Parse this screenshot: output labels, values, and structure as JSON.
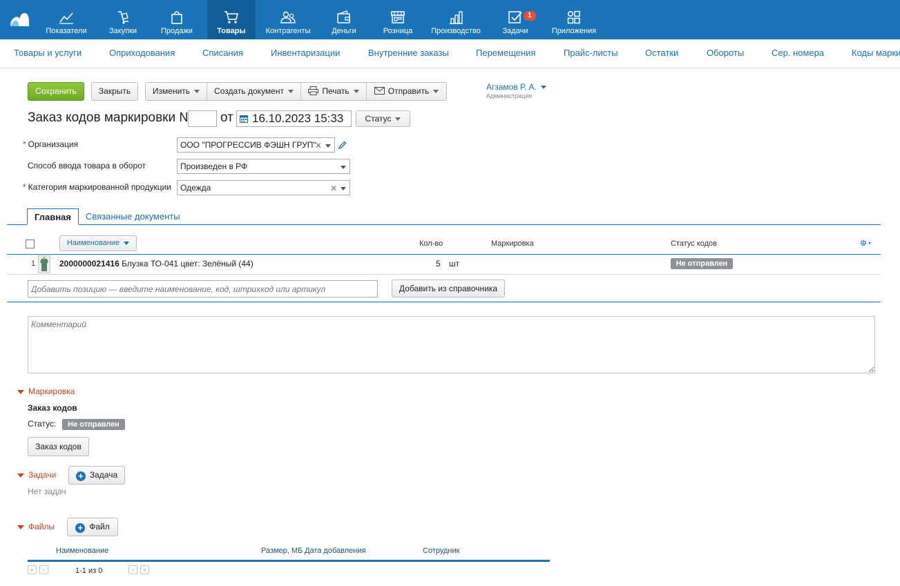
{
  "nav": {
    "items": [
      {
        "label": "Показатели",
        "icon": "chart-line-icon"
      },
      {
        "label": "Закупки",
        "icon": "dolly-icon"
      },
      {
        "label": "Продажи",
        "icon": "shopping-bag-icon"
      },
      {
        "label": "Товары",
        "icon": "cart-icon",
        "active": true
      },
      {
        "label": "Контрагенты",
        "icon": "people-icon"
      },
      {
        "label": "Деньги",
        "icon": "wallet-icon"
      },
      {
        "label": "Розница",
        "icon": "store-icon"
      },
      {
        "label": "Производство",
        "icon": "factory-icon"
      },
      {
        "label": "Задачи",
        "icon": "checkbox-icon",
        "badge": "1"
      },
      {
        "label": "Приложения",
        "icon": "apps-icon"
      }
    ]
  },
  "subnav": [
    "Товары и услуги",
    "Оприходования",
    "Списания",
    "Инвентаризации",
    "Внутренние заказы",
    "Перемещения",
    "Прайс-листы",
    "Остатки",
    "Обороты",
    "Сер. номера",
    "Коды маркир"
  ],
  "toolbar": {
    "save": "Сохранить",
    "close": "Закрыть",
    "edit": "Изменить",
    "create_doc": "Создать документ",
    "print": "Печать",
    "send": "Отправить"
  },
  "user": {
    "name": "Агзамов Р. А.",
    "role": "Администрация"
  },
  "doc": {
    "title": "Заказ кодов маркировки №",
    "number": "",
    "from": "от",
    "date": "16.10.2023 15:33",
    "status_btn": "Статус"
  },
  "form": {
    "org_label": "Организация",
    "org_value": "ООО \"ПРОГРЕССИВ ФЭШН ГРУП\"",
    "method_label": "Способ ввода товара в оборот",
    "method_value": "Произведен в РФ",
    "category_label": "Категория маркированной продукции",
    "category_value": "Одежда"
  },
  "tabs": {
    "main": "Главная",
    "related": "Связанные документы"
  },
  "table": {
    "headers": {
      "name": "Наименование",
      "qty": "Кол-во",
      "marking": "Маркировка",
      "status": "Статус кодов"
    },
    "rows": [
      {
        "index": "1",
        "code": "2000000021416",
        "name": " Блузка ТО-041 цвет: Зелёный (44)",
        "qty": "5",
        "unit": "шт",
        "marking": "",
        "status": "Не отправлен"
      }
    ],
    "add_placeholder": "Добавить позицию — введите наименование, код, штрихкод или артикул",
    "add_from_catalog": "Добавить из справочника"
  },
  "comment_placeholder": "Комментарий",
  "marking": {
    "section": "Маркировка",
    "subtitle": "Заказ кодов",
    "status_label": "Статус:",
    "status_value": "Не отправлен",
    "button": "Заказ кодов"
  },
  "tasks": {
    "section": "Задачи",
    "button": "Задача",
    "empty": "Нет задач"
  },
  "files": {
    "section": "Файлы",
    "button": "Файл",
    "headers": {
      "name": "Наименование",
      "size": "Размер, МБ",
      "date": "Дата добавления",
      "employee": "Сотрудник"
    },
    "pager": "1-1 из 0"
  },
  "colors": {
    "nav_bg": "#1c74b8",
    "nav_active": "#135d99",
    "save_green": "#7ab82c",
    "badge_red": "#e5513e",
    "section_orange": "#c4451e"
  }
}
